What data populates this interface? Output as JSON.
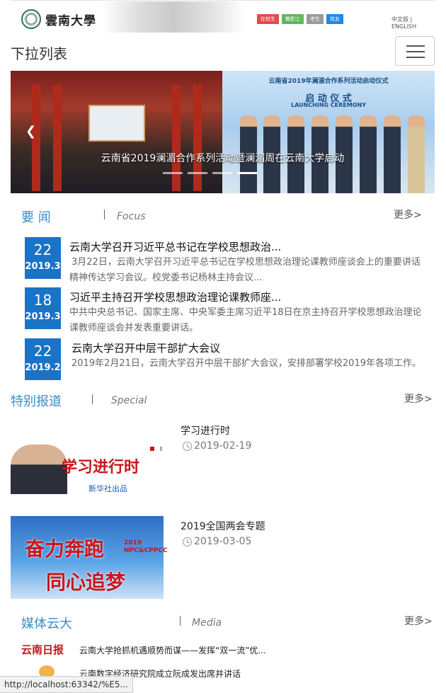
{
  "header": {
    "logo_text": "雲南大學",
    "roles": [
      {
        "label": "在校生",
        "color": "#e24b4b"
      },
      {
        "label": "教职工",
        "color": "#5fb85c"
      },
      {
        "label": "考生",
        "color": "#9a9a9a"
      },
      {
        "label": "校友",
        "color": "#1e88e5"
      }
    ],
    "lang": "中文版 | ENGLISH"
  },
  "nav": {
    "title": "下拉列表"
  },
  "carousel": {
    "caption": "云南省2019澜湄合作系列活动暨澜湄周在云南大学启动",
    "slide_b_header": "云南省2019年澜湄合作系列活动启动仪式",
    "slide_b_title": "启 动 仪 式",
    "slide_b_subtitle": "LAUNCHING CEREMONY",
    "dots": 4,
    "active_dot": 3
  },
  "focus": {
    "title": "要 闻",
    "en": "Focus",
    "more": "更多>",
    "items": [
      {
        "day": "22",
        "ym": "2019.3",
        "title": "云南大学召开习近平总书记在学校思想政治...",
        "desc": "3月22日，云南大学召开习近平总书记在学校思想政治理论课教师座谈会上的重要讲话精神传达学习会议。校党委书记杨林主持会议..."
      },
      {
        "day": "18",
        "ym": "2019.3",
        "title": "习近平主持召开学校思想政治理论课教师座...",
        "desc": "中共中央总书记、国家主席、中央军委主席习近平18日在京主持召开学校思想政治理论课教师座谈会并发表重要讲话。"
      },
      {
        "day": "22",
        "ym": "2019.2",
        "title": "云南大学召开中层干部扩大会议",
        "desc": "2019年2月21日，云南大学召开中层干部扩大会议，安排部署学校2019年各项工作。"
      }
    ]
  },
  "special": {
    "title": "特别报道",
    "en": "Special",
    "more": "更多>",
    "items": [
      {
        "title": "学习进行时",
        "date": "2019-02-19",
        "img_text": "学习进行时",
        "img_sub": "新华社出品"
      },
      {
        "title": "2019全国两会专题",
        "date": "2019-03-05",
        "img_line1": "奋力奔跑",
        "img_line2": "同心追梦",
        "img_tag": "2019 NPC&CPPCC"
      }
    ]
  },
  "media": {
    "title": "媒体云大",
    "en": "Media",
    "more": "更多>",
    "items": [
      {
        "source": "云南日报",
        "title": "云南大学抢抓机遇顺势而谋——发挥“双一流”优..."
      },
      {
        "source": "",
        "title": "云南数字经济研究院成立阮成发出席并讲话"
      }
    ]
  },
  "status_url": "http://localhost:63342/%E5..."
}
